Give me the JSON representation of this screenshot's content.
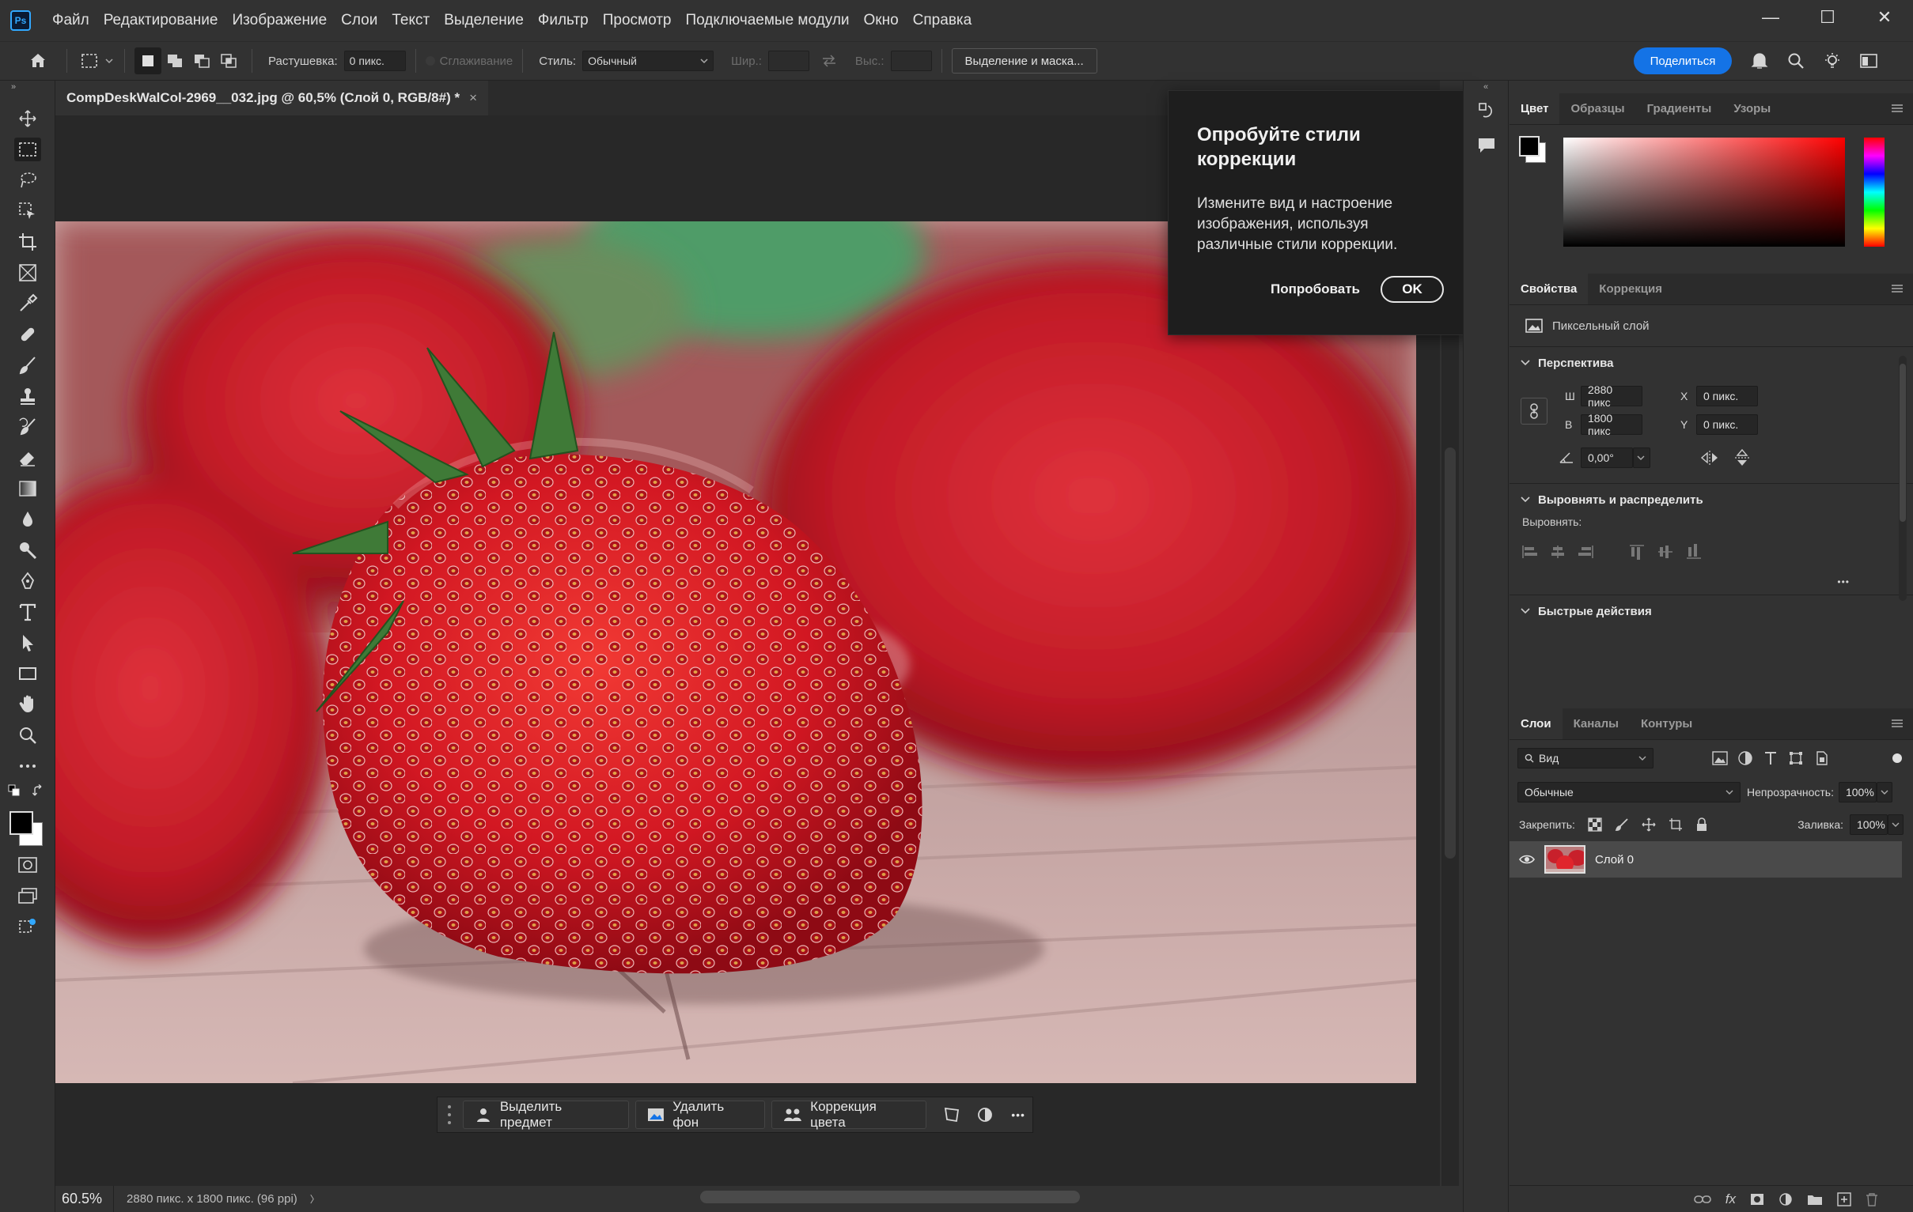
{
  "app": {
    "logo": "Ps",
    "menu": [
      "Файл",
      "Редактирование",
      "Изображение",
      "Слои",
      "Текст",
      "Выделение",
      "Фильтр",
      "Просмотр",
      "Подключаемые модули",
      "Окно",
      "Справка"
    ]
  },
  "window_controls": {
    "minimize": "—",
    "maximize": "☐",
    "close": "✕"
  },
  "options": {
    "feather_label": "Растушевка:",
    "feather_value": "0 пикс.",
    "antialias_label": "Сглаживание",
    "style_label": "Стиль:",
    "style_value": "Обычный",
    "width_label": "Шир.:",
    "height_label": "Выс.:",
    "select_mask_button": "Выделение и маска..."
  },
  "share_button": "Поделиться",
  "document": {
    "tab_title": "CompDeskWalCol-2969__032.jpg @ 60,5% (Слой 0, RGB/8#) *",
    "close": "×"
  },
  "popover": {
    "title": "Опробуйте стили коррекции",
    "body": "Измените вид и настроение изображения, используя различные стили коррекции.",
    "try_button": "Попробовать",
    "ok_button": "OK"
  },
  "taskbar": {
    "select_subject": "Выделить предмет",
    "remove_bg": "Удалить фон",
    "color_correction": "Коррекция цвета",
    "more": "•••"
  },
  "status": {
    "zoom": "60.5%",
    "info": "2880 пикс. x 1800 пикс. (96 ppi)",
    "arrow": "〉"
  },
  "color_panel": {
    "tabs": [
      "Цвет",
      "Образцы",
      "Градиенты",
      "Узоры"
    ],
    "foreground": "#000000",
    "background": "#ffffff"
  },
  "properties": {
    "tabs": [
      "Свойства",
      "Коррекция"
    ],
    "layer_type": "Пиксельный слой",
    "transform_title": "Перспектива",
    "w_label": "Ш",
    "w_value": "2880 пикс",
    "h_label": "В",
    "h_value": "1800 пикс",
    "x_label": "X",
    "x_value": "0 пикс.",
    "y_label": "Y",
    "y_value": "0 пикс.",
    "angle_value": "0,00°",
    "align_title": "Выровнять и распределить",
    "align_label": "Выровнять:",
    "align_more": "•••",
    "quick_title": "Быстрые действия"
  },
  "layers": {
    "tabs": [
      "Слои",
      "Каналы",
      "Контуры"
    ],
    "filter_value": "Вид",
    "blend_mode": "Обычные",
    "opacity_label": "Непрозрачность:",
    "opacity_value": "100%",
    "lock_label": "Закрепить:",
    "fill_label": "Заливка:",
    "fill_value": "100%",
    "items": [
      {
        "name": "Слой 0"
      }
    ],
    "footer_fx": "fx"
  }
}
